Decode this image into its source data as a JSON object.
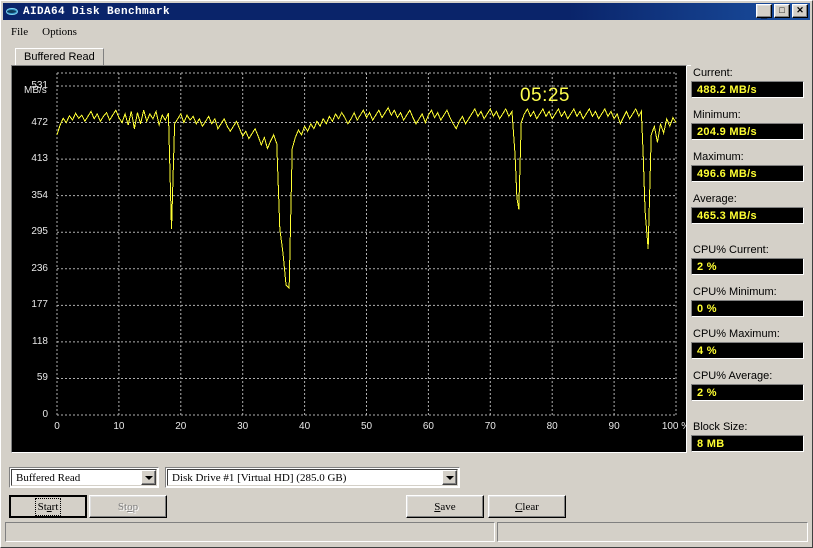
{
  "window": {
    "title": "AIDA64 Disk Benchmark",
    "icon": "disk-icon",
    "minimize_label": "_",
    "maximize_label": "□",
    "close_label": "✕"
  },
  "menu": {
    "items": [
      {
        "label": "File"
      },
      {
        "label": "Options"
      }
    ]
  },
  "tabs": [
    {
      "label": "Buffered Read",
      "active": true
    }
  ],
  "chart_panel": {
    "timer": "05:25",
    "y_unit": "MB/s"
  },
  "readouts": [
    {
      "label": "Current:",
      "value": "488.2 MB/s"
    },
    {
      "label": "Minimum:",
      "value": "204.9 MB/s"
    },
    {
      "label": "Maximum:",
      "value": "496.6 MB/s"
    },
    {
      "label": "Average:",
      "value": "465.3 MB/s"
    },
    {
      "label": "CPU% Current:",
      "value": "2 %"
    },
    {
      "label": "CPU% Minimum:",
      "value": "0 %"
    },
    {
      "label": "CPU% Maximum:",
      "value": "4 %"
    },
    {
      "label": "CPU% Average:",
      "value": "2 %"
    },
    {
      "label": "Block Size:",
      "value": "8 MB"
    }
  ],
  "controls": {
    "test_combo": {
      "value": "Buffered Read"
    },
    "drive_combo": {
      "value": "Disk Drive #1  [Virtual HD]  (285.0 GB)"
    },
    "start_button": {
      "label_pre": "St",
      "label_mn": "a",
      "label_post": "rt",
      "enabled": true
    },
    "stop_button": {
      "label_pre": "St",
      "label_mn": "o",
      "label_post": "p",
      "enabled": false
    },
    "save_button": {
      "label_pre": "",
      "label_mn": "S",
      "label_post": "ave",
      "enabled": true
    },
    "clear_button": {
      "label_pre": "",
      "label_mn": "C",
      "label_post": "lear",
      "enabled": true
    }
  },
  "status_bar": {
    "panel1": "",
    "panel2": ""
  },
  "colors": {
    "trace": "#ffff33",
    "grid": "#b0b0b0",
    "plot_bg": "#000000",
    "readout_text": "#ffff33",
    "face": "#d4d0c8",
    "title_bg": "#0a246a"
  },
  "chart_data": {
    "type": "line",
    "title": "Buffered Read",
    "xlabel": "%",
    "ylabel": "MB/s",
    "xlim": [
      0,
      100
    ],
    "ylim": [
      0,
      531
    ],
    "grid": true,
    "legend": false,
    "xticks": [
      0,
      10,
      20,
      30,
      40,
      50,
      60,
      70,
      80,
      90,
      100
    ],
    "xtick_labels": [
      "0",
      "10",
      "20",
      "30",
      "40",
      "50",
      "60",
      "70",
      "80",
      "90",
      "100 %"
    ],
    "yticks": [
      0,
      59,
      118,
      177,
      236,
      295,
      354,
      413,
      472,
      531
    ],
    "ytick_labels": [
      "0",
      "59",
      "118",
      "177",
      "236",
      "295",
      "354",
      "413",
      "472",
      "531"
    ],
    "annotations": [
      {
        "text": "05:25",
        "x": 67,
        "y": 520
      }
    ],
    "series": [
      {
        "name": "Buffered Read (MB/s)",
        "color": "#ffff33",
        "x": [
          0.0,
          0.5,
          1.0,
          1.5,
          2.0,
          2.5,
          3.0,
          3.5,
          4.0,
          4.5,
          5.0,
          5.5,
          6.0,
          6.5,
          7.0,
          7.5,
          8.0,
          8.5,
          9.0,
          9.5,
          10.0,
          10.5,
          11.0,
          11.5,
          12.0,
          12.5,
          13.0,
          13.5,
          14.0,
          14.5,
          15.0,
          15.5,
          16.0,
          16.5,
          17.0,
          17.5,
          18.0,
          18.5,
          19.0,
          19.5,
          20.0,
          20.5,
          21.0,
          21.5,
          22.0,
          22.5,
          23.0,
          23.5,
          24.0,
          24.5,
          25.0,
          25.5,
          26.0,
          26.5,
          27.0,
          27.5,
          28.0,
          28.5,
          29.0,
          29.5,
          30.0,
          30.5,
          31.0,
          31.5,
          32.0,
          32.5,
          33.0,
          33.5,
          34.0,
          34.5,
          35.0,
          35.5,
          36.0,
          36.5,
          37.0,
          37.5,
          38.0,
          38.5,
          39.0,
          39.5,
          40.0,
          40.5,
          41.0,
          41.5,
          42.0,
          42.5,
          43.0,
          43.5,
          44.0,
          44.5,
          45.0,
          45.5,
          46.0,
          46.5,
          47.0,
          47.5,
          48.0,
          48.5,
          49.0,
          49.5,
          50.0,
          50.5,
          51.0,
          51.5,
          52.0,
          52.5,
          53.0,
          53.5,
          54.0,
          54.5,
          55.0,
          55.5,
          56.0,
          56.5,
          57.0,
          57.5,
          58.0,
          58.5,
          59.0,
          59.5,
          60.0,
          60.5,
          61.0,
          61.5,
          62.0,
          62.5,
          63.0,
          63.5,
          64.0,
          64.5,
          65.0,
          65.5,
          66.0,
          66.5,
          67.0,
          67.5,
          68.0,
          68.5,
          69.0,
          69.5,
          70.0,
          70.5,
          71.0,
          71.5,
          72.0,
          72.5,
          73.0,
          73.5,
          74.0,
          74.3,
          74.6,
          75.0,
          75.5,
          76.0,
          76.5,
          77.0,
          77.5,
          78.0,
          78.5,
          79.0,
          79.5,
          80.0,
          80.5,
          81.0,
          81.5,
          82.0,
          82.5,
          83.0,
          83.5,
          84.0,
          84.5,
          85.0,
          85.5,
          86.0,
          86.5,
          87.0,
          87.5,
          88.0,
          88.5,
          89.0,
          89.5,
          90.0,
          90.5,
          91.0,
          91.5,
          92.0,
          92.5,
          93.0,
          93.5,
          94.0,
          94.4,
          94.7,
          95.0,
          95.5,
          96.0,
          96.5,
          97.0,
          97.5,
          98.0,
          98.5,
          99.0,
          99.5,
          100.0
        ],
        "y": [
          452,
          468,
          479,
          472,
          483,
          476,
          487,
          479,
          484,
          474,
          482,
          490,
          478,
          486,
          474,
          482,
          488,
          476,
          484,
          492,
          480,
          472,
          486,
          468,
          490,
          462,
          488,
          470,
          492,
          474,
          486,
          478,
          490,
          468,
          484,
          476,
          487,
          300,
          470,
          478,
          486,
          472,
          484,
          476,
          482,
          470,
          478,
          466,
          474,
          482,
          470,
          478,
          462,
          470,
          478,
          466,
          458,
          466,
          474,
          462,
          450,
          458,
          446,
          454,
          462,
          450,
          436,
          448,
          430,
          442,
          452,
          438,
          300,
          262,
          210,
          205,
          430,
          448,
          460,
          452,
          466,
          458,
          470,
          462,
          474,
          466,
          478,
          470,
          482,
          474,
          486,
          478,
          488,
          480,
          470,
          478,
          488,
          476,
          484,
          492,
          480,
          488,
          476,
          484,
          492,
          480,
          488,
          496,
          484,
          492,
          480,
          488,
          476,
          484,
          492,
          480,
          470,
          478,
          486,
          472,
          484,
          492,
          480,
          488,
          476,
          484,
          492,
          480,
          470,
          462,
          474,
          482,
          470,
          478,
          486,
          494,
          482,
          490,
          478,
          486,
          494,
          482,
          490,
          478,
          486,
          494,
          482,
          490,
          420,
          350,
          332,
          472,
          486,
          494,
          482,
          490,
          478,
          486,
          494,
          482,
          490,
          478,
          486,
          494,
          482,
          490,
          478,
          486,
          494,
          482,
          490,
          478,
          486,
          494,
          482,
          490,
          478,
          486,
          494,
          482,
          490,
          478,
          486,
          470,
          480,
          490,
          478,
          486,
          494,
          482,
          490,
          420,
          330,
          268,
          452,
          466,
          440,
          470,
          455,
          478,
          466,
          480,
          472,
          488
        ]
      }
    ]
  }
}
